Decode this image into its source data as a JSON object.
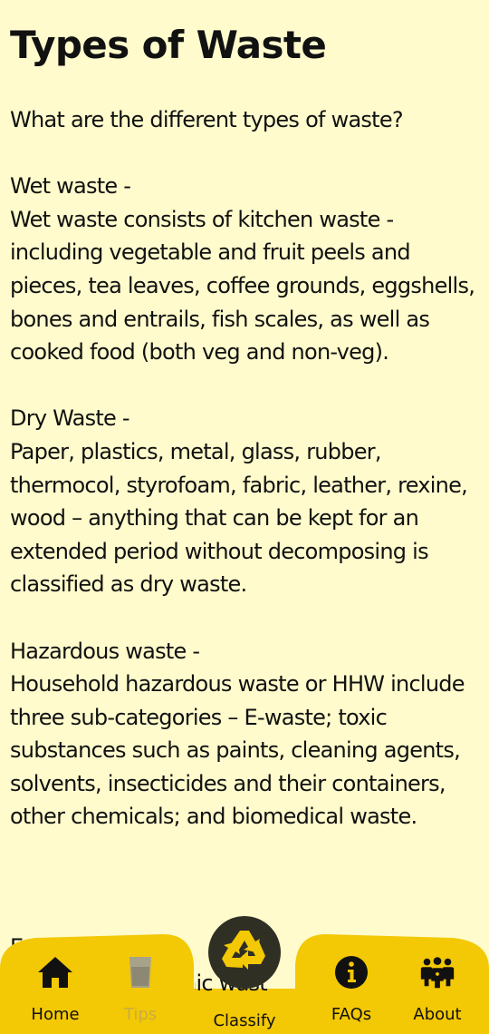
{
  "title": "Types of Waste",
  "paragraphs": [
    "What are the different types of waste?",
    "Wet waste -",
    "Wet waste consists of kitchen waste - including vegetable and fruit peels and pieces, tea leaves, coffee grounds, eggshells, bones and entrails, fish scales, as well as cooked food (both veg and non-veg).",
    "Dry Waste -",
    "Paper, plastics, metal, glass, rubber, thermocol, styrofoam, fabric, leather, rexine, wood – anything that can be kept for an extended period without decomposing is classified as dry waste.",
    "Hazardous waste -",
    "Household hazardous waste or HHW include three sub-categories – E-waste; toxic substances such as paints, cleaning agents, solvents, insecticides and their containers, other chemicals; and biomedical waste.",
    "E-w",
    "nic wast"
  ],
  "nav": {
    "home": {
      "label": "Home",
      "icon": "home-icon"
    },
    "tips": {
      "label": "Tips",
      "icon": "glass-icon",
      "state": "disabled"
    },
    "classify": {
      "label": "Classify",
      "icon": "recycle-icon"
    },
    "faqs": {
      "label": "FAQs",
      "icon": "info-icon"
    },
    "about": {
      "label": "About",
      "icon": "group-icon"
    }
  },
  "colors": {
    "background": "#fffbcc",
    "nav_bar": "#f3c804",
    "fab": "#2f2f24",
    "fab_icon": "#f3c804",
    "text": "#111111",
    "disabled": "#c9ad40"
  }
}
